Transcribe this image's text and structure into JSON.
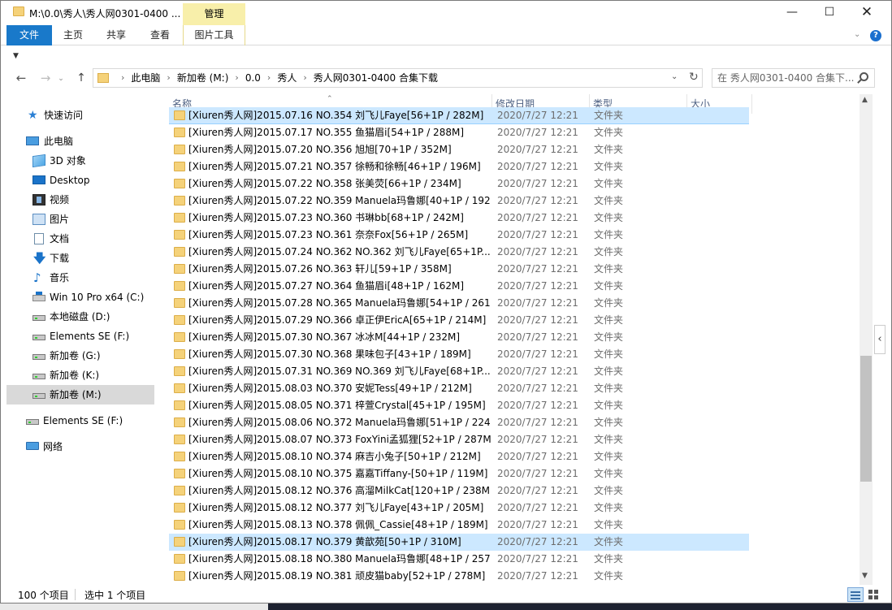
{
  "window": {
    "title": "M:\\0.0\\秀人\\秀人网0301-0400 ...",
    "contextual_tab_group": "管理"
  },
  "ribbon": {
    "tabs": [
      {
        "label": "文件",
        "active": true
      },
      {
        "label": "主页"
      },
      {
        "label": "共享"
      },
      {
        "label": "查看"
      },
      {
        "label": "图片工具"
      }
    ],
    "help_glyph": "?"
  },
  "address": {
    "crumbs": [
      "此电脑",
      "新加卷 (M:)",
      "0.0",
      "秀人",
      "秀人网0301-0400 合集下载"
    ],
    "search_placeholder": "在 秀人网0301-0400 合集下..."
  },
  "sidebar": {
    "items": [
      {
        "label": "快速访问",
        "icon": "star-icon"
      },
      {
        "label": "此电脑",
        "icon": "computer-icon"
      },
      {
        "label": "3D 对象",
        "icon": "3d-objects-icon"
      },
      {
        "label": "Desktop",
        "icon": "desktop-icon"
      },
      {
        "label": "视频",
        "icon": "video-icon"
      },
      {
        "label": "图片",
        "icon": "pictures-icon"
      },
      {
        "label": "文档",
        "icon": "documents-icon"
      },
      {
        "label": "下载",
        "icon": "download-icon"
      },
      {
        "label": "音乐",
        "icon": "music-icon"
      },
      {
        "label": "Win 10 Pro x64 (C:)",
        "icon": "system-drive-icon"
      },
      {
        "label": "本地磁盘 (D:)",
        "icon": "drive-icon"
      },
      {
        "label": "Elements SE (F:)",
        "icon": "drive-icon"
      },
      {
        "label": "新加卷 (G:)",
        "icon": "drive-icon"
      },
      {
        "label": "新加卷 (K:)",
        "icon": "drive-icon"
      },
      {
        "label": "新加卷 (M:)",
        "icon": "drive-icon",
        "selected": true
      },
      {
        "label": "Elements SE (F:)",
        "icon": "drive-icon"
      },
      {
        "label": "网络",
        "icon": "network-icon"
      }
    ]
  },
  "columns": [
    "名称",
    "修改日期",
    "类型",
    "大小"
  ],
  "files": [
    {
      "name": "[Xiuren秀人网]2015.07.16 NO.354 刘飞儿Faye[56+1P / 282M]",
      "date": "2020/7/27 12:21",
      "type": "文件夹",
      "selected": true
    },
    {
      "name": "[Xiuren秀人网]2015.07.17 NO.355 鱼猫眉i[54+1P / 288M]",
      "date": "2020/7/27 12:21",
      "type": "文件夹"
    },
    {
      "name": "[Xiuren秀人网]2015.07.20 NO.356 旭旭[70+1P / 352M]",
      "date": "2020/7/27 12:21",
      "type": "文件夹"
    },
    {
      "name": "[Xiuren秀人网]2015.07.21 NO.357 徐畅和徐畅[46+1P / 196M]",
      "date": "2020/7/27 12:21",
      "type": "文件夹"
    },
    {
      "name": "[Xiuren秀人网]2015.07.22 NO.358 张美荧[66+1P / 234M]",
      "date": "2020/7/27 12:21",
      "type": "文件夹"
    },
    {
      "name": "[Xiuren秀人网]2015.07.22 NO.359 Manuela玛鲁娜[40+1P / 192...",
      "date": "2020/7/27 12:21",
      "type": "文件夹"
    },
    {
      "name": "[Xiuren秀人网]2015.07.23 NO.360 书琳bb[68+1P / 242M]",
      "date": "2020/7/27 12:21",
      "type": "文件夹"
    },
    {
      "name": "[Xiuren秀人网]2015.07.23 NO.361 奈奈Fox[56+1P / 265M]",
      "date": "2020/7/27 12:21",
      "type": "文件夹"
    },
    {
      "name": "[Xiuren秀人网]2015.07.24 NO.362 NO.362 刘飞儿Faye[65+1P...",
      "date": "2020/7/27 12:21",
      "type": "文件夹"
    },
    {
      "name": "[Xiuren秀人网]2015.07.26 NO.363 轩儿[59+1P / 358M]",
      "date": "2020/7/27 12:21",
      "type": "文件夹"
    },
    {
      "name": "[Xiuren秀人网]2015.07.27 NO.364 鱼猫眉i[48+1P / 162M]",
      "date": "2020/7/27 12:21",
      "type": "文件夹"
    },
    {
      "name": "[Xiuren秀人网]2015.07.28 NO.365 Manuela玛鲁娜[54+1P / 261...",
      "date": "2020/7/27 12:21",
      "type": "文件夹"
    },
    {
      "name": "[Xiuren秀人网]2015.07.29 NO.366 卓正伊EricA[65+1P / 214M]",
      "date": "2020/7/27 12:21",
      "type": "文件夹"
    },
    {
      "name": "[Xiuren秀人网]2015.07.30 NO.367 冰冰M[44+1P / 232M]",
      "date": "2020/7/27 12:21",
      "type": "文件夹"
    },
    {
      "name": "[Xiuren秀人网]2015.07.30 NO.368 果味包子[43+1P / 189M]",
      "date": "2020/7/27 12:21",
      "type": "文件夹"
    },
    {
      "name": "[Xiuren秀人网]2015.07.31 NO.369 NO.369 刘飞儿Faye[68+1P...",
      "date": "2020/7/27 12:21",
      "type": "文件夹"
    },
    {
      "name": "[Xiuren秀人网]2015.08.03 NO.370 安妮Tess[49+1P / 212M]",
      "date": "2020/7/27 12:21",
      "type": "文件夹"
    },
    {
      "name": "[Xiuren秀人网]2015.08.05 NO.371 梓萱Crystal[45+1P / 195M]",
      "date": "2020/7/27 12:21",
      "type": "文件夹"
    },
    {
      "name": "[Xiuren秀人网]2015.08.06 NO.372 Manuela玛鲁娜[51+1P / 224...",
      "date": "2020/7/27 12:21",
      "type": "文件夹"
    },
    {
      "name": "[Xiuren秀人网]2015.08.07 NO.373 FoxYini孟狐狸[52+1P / 287M]",
      "date": "2020/7/27 12:21",
      "type": "文件夹"
    },
    {
      "name": "[Xiuren秀人网]2015.08.10 NO.374 麻吉小兔子[50+1P / 212M]",
      "date": "2020/7/27 12:21",
      "type": "文件夹"
    },
    {
      "name": "[Xiuren秀人网]2015.08.10 NO.375 嘉嘉Tiffany-[50+1P / 119M]",
      "date": "2020/7/27 12:21",
      "type": "文件夹"
    },
    {
      "name": "[Xiuren秀人网]2015.08.12 NO.376 高溜MilkCat[120+1P / 238M]",
      "date": "2020/7/27 12:21",
      "type": "文件夹"
    },
    {
      "name": "[Xiuren秀人网]2015.08.12 NO.377 刘飞儿Faye[43+1P / 205M]",
      "date": "2020/7/27 12:21",
      "type": "文件夹"
    },
    {
      "name": "[Xiuren秀人网]2015.08.13 NO.378 佩佩_Cassie[48+1P / 189M]",
      "date": "2020/7/27 12:21",
      "type": "文件夹"
    },
    {
      "name": "[Xiuren秀人网]2015.08.17 NO.379 黄歆苑[50+1P / 310M]",
      "date": "2020/7/27 12:21",
      "type": "文件夹",
      "hover": true
    },
    {
      "name": "[Xiuren秀人网]2015.08.18 NO.380 Manuela玛鲁娜[48+1P / 257...",
      "date": "2020/7/27 12:21",
      "type": "文件夹"
    },
    {
      "name": "[Xiuren秀人网]2015.08.19 NO.381 顽皮猫baby[52+1P / 278M]",
      "date": "2020/7/27 12:21",
      "type": "文件夹"
    }
  ],
  "status": {
    "count": "100 个项目",
    "selected": "选中 1 个项目"
  },
  "colors": {
    "accent": "#1979ca",
    "selection": "#cce8ff",
    "contextual_tab": "#f8efaa"
  }
}
